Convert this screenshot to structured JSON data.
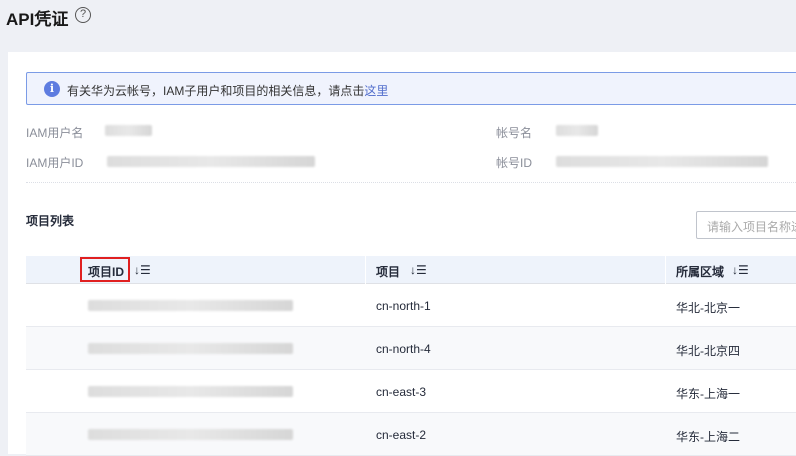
{
  "header": {
    "title": "API凭证",
    "help_icon": "?"
  },
  "info": {
    "text": "有关华为云帐号，IAM子用户和项目的相关信息，请点击",
    "link": "这里",
    "icon": "i"
  },
  "account": {
    "iam_user_name_label": "IAM用户名",
    "iam_user_id_label": "IAM用户ID",
    "account_name_label": "帐号名",
    "account_id_label": "帐号ID"
  },
  "projects": {
    "title": "项目列表",
    "search_placeholder": "请输入项目名称进行搜索",
    "columns": [
      "项目ID",
      "项目",
      "所属区域"
    ],
    "sort_icon": "↓☰",
    "rows": [
      {
        "project": "cn-north-1",
        "region": "华北-北京一"
      },
      {
        "project": "cn-north-4",
        "region": "华北-北京四"
      },
      {
        "project": "cn-east-3",
        "region": "华东-上海一"
      },
      {
        "project": "cn-east-2",
        "region": "华东-上海二"
      }
    ]
  }
}
